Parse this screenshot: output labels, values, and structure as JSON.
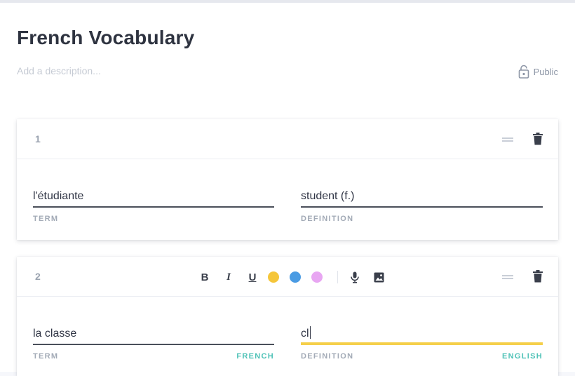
{
  "set": {
    "title": "French Vocabulary",
    "description_placeholder": "Add a description...",
    "visibility_label": "Public"
  },
  "colors": {
    "accent_highlight": "#f5cf4a",
    "language_label": "#4fc2b7",
    "color_swatches": [
      "#f5c63a",
      "#4a9be3",
      "#e8a6f2"
    ]
  },
  "toolbar": {
    "bold_label": "B",
    "italic_label": "I",
    "underline_label": "U",
    "icons": [
      "microphone-icon",
      "image-icon"
    ]
  },
  "cards": [
    {
      "number": "1",
      "term": "l'étudiante",
      "definition": "student (f.)",
      "term_label": "TERM",
      "definition_label": "DEFINITION"
    },
    {
      "number": "2",
      "term": "la classe",
      "definition": "cl",
      "term_label": "TERM",
      "definition_label": "DEFINITION",
      "term_language": "FRENCH",
      "definition_language": "ENGLISH"
    }
  ]
}
